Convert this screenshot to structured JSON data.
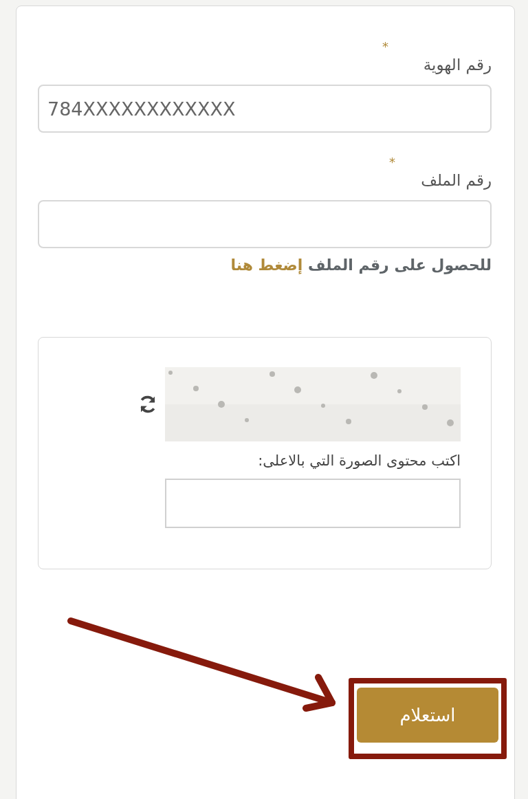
{
  "fields": [
    {
      "label": "رقم الهوية",
      "required_mark": "*",
      "value": "784XXXXXXXXXXXX"
    },
    {
      "label": "رقم الملف",
      "required_mark": "*"
    }
  ],
  "hint": {
    "text": "للحصول على رقم الملف",
    "link": "إضغط هنا"
  },
  "captcha": {
    "prompt": "اكتب محتوى الصورة التي بالاعلى:"
  },
  "submit": {
    "label": "استعلام"
  },
  "annotations": {
    "arrow": true,
    "highlight_frame": true
  }
}
